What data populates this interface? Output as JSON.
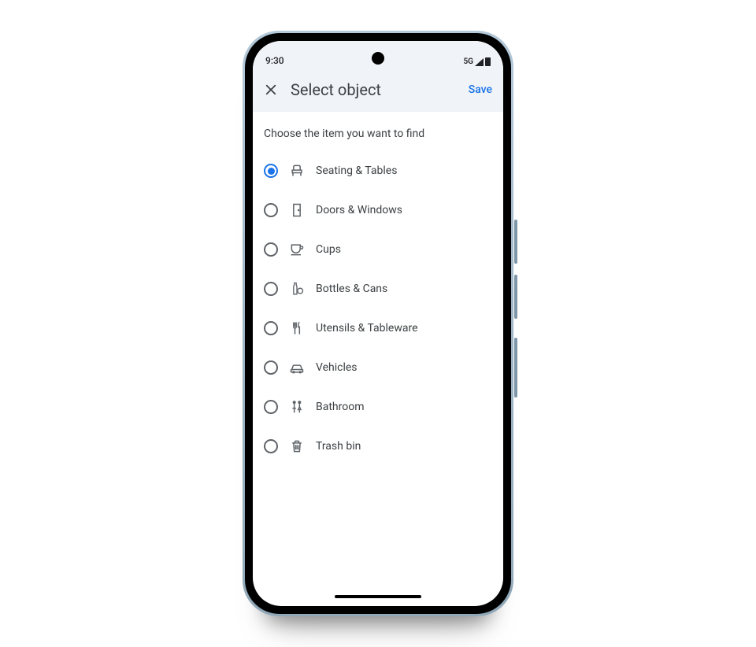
{
  "status_bar": {
    "time": "9:30",
    "network_label": "5G"
  },
  "app_bar": {
    "title": "Select object",
    "save_label": "Save"
  },
  "content": {
    "prompt": "Choose the item you want to find"
  },
  "options": [
    {
      "id": "seating-tables",
      "label": "Seating & Tables",
      "icon": "chair-icon",
      "selected": true
    },
    {
      "id": "doors-windows",
      "label": "Doors & Windows",
      "icon": "door-icon",
      "selected": false
    },
    {
      "id": "cups",
      "label": "Cups",
      "icon": "cup-icon",
      "selected": false
    },
    {
      "id": "bottles-cans",
      "label": "Bottles & Cans",
      "icon": "bottle-icon",
      "selected": false
    },
    {
      "id": "utensils",
      "label": "Utensils & Tableware",
      "icon": "utensils-icon",
      "selected": false
    },
    {
      "id": "vehicles",
      "label": "Vehicles",
      "icon": "car-icon",
      "selected": false
    },
    {
      "id": "bathroom",
      "label": "Bathroom",
      "icon": "restroom-icon",
      "selected": false
    },
    {
      "id": "trash-bin",
      "label": "Trash bin",
      "icon": "trash-icon",
      "selected": false
    }
  ]
}
